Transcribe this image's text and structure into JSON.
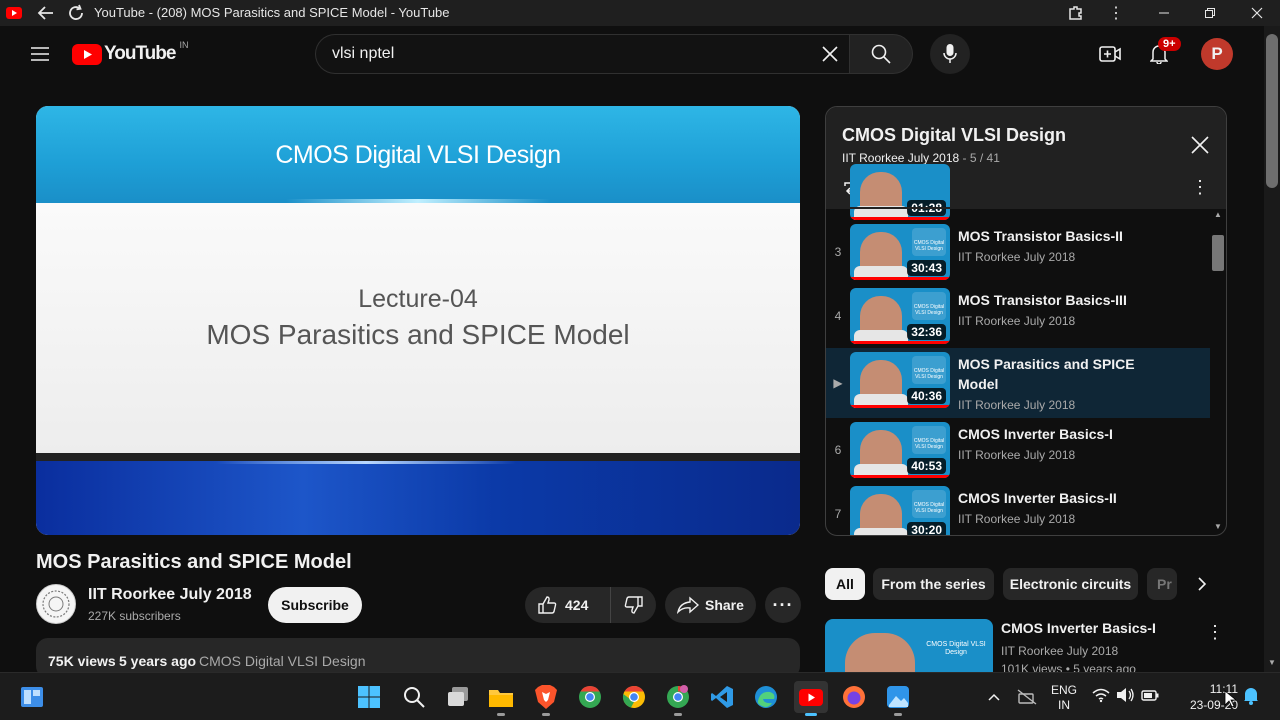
{
  "window": {
    "title": "YouTube - (208) MOS Parasitics and SPICE Model - YouTube"
  },
  "masthead": {
    "logo_text": "YouTube",
    "country_code": "IN",
    "search_value": "vlsi nptel",
    "notifications_badge": "9+",
    "avatar_letter": "P"
  },
  "video": {
    "slide_title": "CMOS Digital VLSI Design",
    "slide_lecture": "Lecture-04",
    "slide_topic": "MOS Parasitics and SPICE Model",
    "title": "MOS Parasitics and SPICE Model",
    "channel": "IIT Roorkee July 2018",
    "subscribers": "227K subscribers",
    "subscribe_label": "Subscribe",
    "likes": "424",
    "share_label": "Share",
    "views": "75K views",
    "age": "5 years ago",
    "playlist_link": "CMOS Digital VLSI Design"
  },
  "playlist": {
    "title": "CMOS Digital VLSI Design",
    "channel": "IIT Roorkee July 2018",
    "position": "- 5 / 41",
    "partial_duration": "01:28",
    "items": [
      {
        "index": "3",
        "title": "MOS Transistor Basics-II",
        "channel": "IIT Roorkee July 2018",
        "duration": "30:43",
        "current": false
      },
      {
        "index": "4",
        "title": "MOS Transistor Basics-III",
        "channel": "IIT Roorkee July 2018",
        "duration": "32:36",
        "current": false
      },
      {
        "index": "▶",
        "title": "MOS Parasitics and SPICE Model",
        "channel": "IIT Roorkee July 2018",
        "duration": "40:36",
        "current": true
      },
      {
        "index": "6",
        "title": "CMOS Inverter Basics-I",
        "channel": "IIT Roorkee July 2018",
        "duration": "40:53",
        "current": false
      },
      {
        "index": "7",
        "title": "CMOS Inverter Basics-II",
        "channel": "IIT Roorkee July 2018",
        "duration": "30:20",
        "current": false
      }
    ]
  },
  "chips": {
    "all": "All",
    "series": "From the series",
    "electronic": "Electronic circuits",
    "partial": "Pr"
  },
  "recommended": {
    "title": "CMOS Inverter Basics-I",
    "channel": "IIT Roorkee July 2018",
    "meta": "101K views • 5 years ago",
    "thumb_text": "CMOS Digital VLSI Design"
  },
  "taskbar": {
    "lang": "ENG",
    "region": "IN",
    "time": "11:11",
    "date": "23-09-20"
  },
  "colors": {
    "youtube_red": "#ff0000",
    "avatar": "#c0392b",
    "selected_row": "#0f2636",
    "slide_blue": "#1e9fd6"
  }
}
